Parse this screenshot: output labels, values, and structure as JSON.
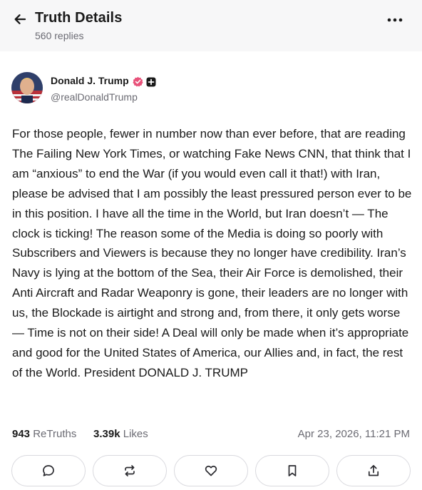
{
  "header": {
    "title": "Truth Details",
    "subtitle": "560 replies",
    "back_icon": "arrow-left-icon",
    "more_icon": "ellipsis-icon"
  },
  "post": {
    "author_name": "Donald J. Trump",
    "author_handle": "@realDonaldTrump",
    "verified_badge_color": "#e8527a",
    "text": "For those people, fewer in number now than ever before, that are reading The Failing New York Times, or watching Fake News CNN, that think that I am “anxious” to end the War (if you would even call it that!) with Iran, please be advised that I am possibly the least pressured person ever to be in this position. I have all the time in the World, but Iran doesn’t — The clock is ticking! The reason some of the Media is doing so poorly with Subscribers and Viewers is because they no longer have credibility. Iran’s Navy is lying at the bottom of the Sea, their Air Force is demolished, their Anti Aircraft and Radar Weaponry is gone, their leaders are no longer with us, the Blockade is airtight and strong and, from there, it only gets worse — Time is not on their side! A Deal will only be made when it’s appropriate and good for the United States of America, our Allies and, in fact, the rest of the World. President DONALD J. TRUMP"
  },
  "stats": {
    "retruths_count": "943",
    "retruths_label": "ReTruths",
    "likes_count": "3.39k",
    "likes_label": "Likes",
    "timestamp": "Apr 23, 2026, 11:21 PM"
  },
  "actions": [
    {
      "icon": "reply-bubble-icon"
    },
    {
      "icon": "retruth-icon"
    },
    {
      "icon": "heart-icon"
    },
    {
      "icon": "bookmark-icon"
    },
    {
      "icon": "share-icon"
    }
  ]
}
